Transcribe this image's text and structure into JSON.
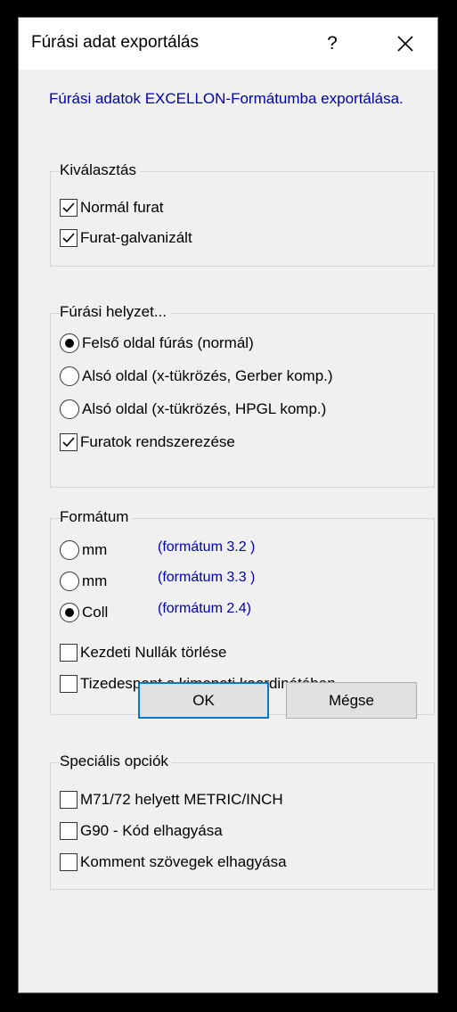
{
  "dialog": {
    "title": "Fúrási adat exportálás",
    "help_label": "?",
    "intro": "Fúrási adatok EXCELLON-Formátumba exportálása."
  },
  "selection": {
    "legend": "Kiválasztás",
    "items": [
      {
        "label": "Normál furat",
        "checked": true
      },
      {
        "label": "Furat-galvanizált",
        "checked": true
      }
    ]
  },
  "drill_position": {
    "legend": "Fúrási helyzet...",
    "radios": [
      {
        "label": "Felső oldal fúrás (normál)",
        "selected": true
      },
      {
        "label": "Alsó oldal (x-tükrözés, Gerber komp.)",
        "selected": false
      },
      {
        "label": "Alsó oldal (x-tükrözés, HPGL komp.)",
        "selected": false
      }
    ],
    "sort_holes": {
      "label": "Furatok rendszerezése",
      "checked": true
    }
  },
  "format": {
    "legend": "Formátum",
    "radios": [
      {
        "label": "mm",
        "hint": "(formátum 3.2 )",
        "selected": false
      },
      {
        "label": "mm",
        "hint": "(formátum 3.3 )",
        "selected": false
      },
      {
        "label": "Coll",
        "hint": "(formátum 2.4)",
        "selected": true
      }
    ],
    "checks": [
      {
        "label": "Kezdeti Nullák törlése",
        "checked": false
      },
      {
        "label": "Tizedespont a kimeneti koordinátában",
        "checked": false
      }
    ]
  },
  "special": {
    "legend": "Speciális opciók",
    "items": [
      {
        "label": "M71/72 helyett METRIC/INCH",
        "checked": false
      },
      {
        "label": "G90 - Kód elhagyása",
        "checked": false
      },
      {
        "label": "Komment szövegek elhagyása",
        "checked": false
      }
    ]
  },
  "buttons": {
    "ok": "OK",
    "cancel": "Mégse"
  },
  "colors": {
    "accent": "#0078d7",
    "info_text": "#0000b4"
  }
}
